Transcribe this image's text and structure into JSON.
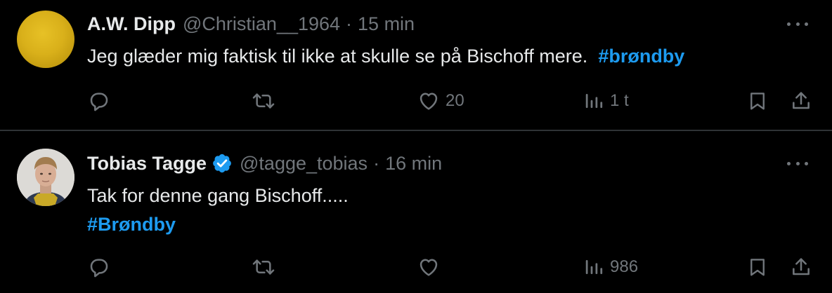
{
  "tweets": [
    {
      "name": "A.W. Dipp",
      "handle": "@Christian__1964",
      "separator": "·",
      "time": "15 min",
      "text": "Jeg glæder mig faktisk til ikke at skulle se på Bischoff mere.",
      "hashtag": "#brøndby",
      "verified": false,
      "likes": "20",
      "views": "1 t",
      "avatar_icon": "yellow-avatar"
    },
    {
      "name": "Tobias Tagge",
      "handle": "@tagge_tobias",
      "separator": "·",
      "time": "16 min",
      "text": "Tak for denne gang Bischoff.....",
      "hashtag": "#Brøndby",
      "verified": true,
      "likes": "",
      "views": "986",
      "avatar_icon": "profile-photo"
    }
  ],
  "colors": {
    "background": "#000000",
    "text": "#e7e9ea",
    "muted": "#71767b",
    "accent": "#1d9bf0",
    "divider": "#2f3336"
  },
  "icons": [
    "reply-icon",
    "retweet-icon",
    "like-icon",
    "views-icon",
    "bookmark-icon",
    "share-icon",
    "more-icon",
    "verified-icon"
  ]
}
